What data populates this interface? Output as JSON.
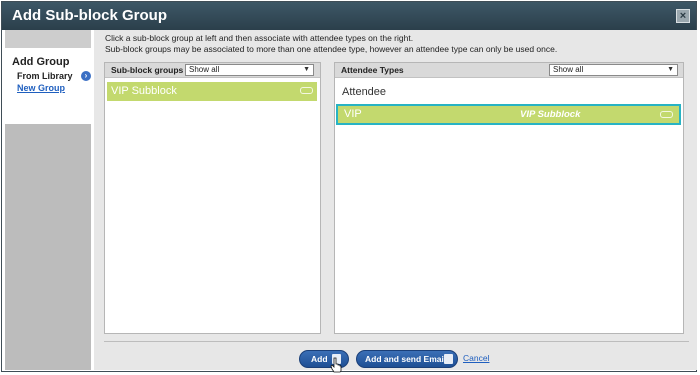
{
  "dialog": {
    "title": "Add Sub-block Group",
    "close_glyph": "×"
  },
  "sidebar": {
    "heading": "Add Group",
    "from_library": "From Library",
    "new_group": "New Group"
  },
  "instructions": {
    "line1": "Click a sub-block group at left and then associate with attendee types on the right.",
    "line2": "Sub-block groups may be associated to more than one attendee type, however an attendee type can only be used once."
  },
  "subblock_panel": {
    "label": "Sub-block groups",
    "filter_value": "Show all",
    "items": [
      {
        "label": "VIP Subblock"
      }
    ]
  },
  "attendee_panel": {
    "label": "Attendee Types",
    "filter_value": "Show all",
    "heading": "Attendee",
    "rows": [
      {
        "name": "VIP",
        "group": "VIP Subblock"
      }
    ]
  },
  "footer": {
    "add_label": "Add",
    "add_email_label": "Add and send Email",
    "cancel_label": "Cancel"
  },
  "colors": {
    "titlebar": "#2f4653",
    "accent_green": "#c3d96e",
    "selected_border": "#27b3c4",
    "button_blue": "#2a5ea6"
  }
}
